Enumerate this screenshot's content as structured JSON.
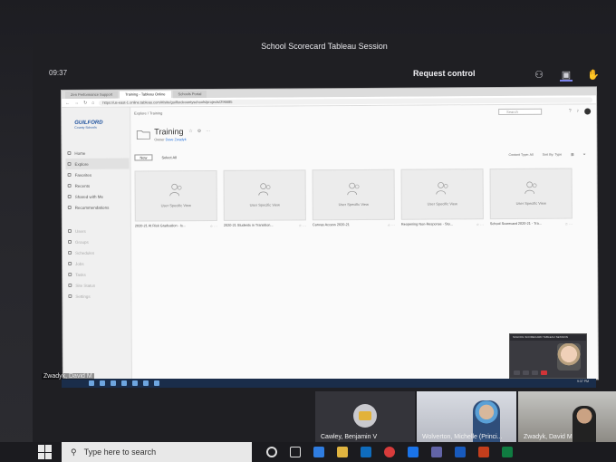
{
  "teams": {
    "title": "School Scorecard Tableau Session",
    "time": "09:37",
    "request_control": "Request control"
  },
  "browser": {
    "tabs": [
      "Zen Performance Support",
      "Training - Tableau Online",
      "Schools Portal"
    ],
    "url": "https://us-east-1.online.tableau.com/#/site/guilfordcountyschools/projects/296685"
  },
  "sidebar": {
    "logo_title": "GUILFORD",
    "logo_sub": "County Schools",
    "items": [
      {
        "label": "Home"
      },
      {
        "label": "Explore"
      },
      {
        "label": "Favorites"
      },
      {
        "label": "Recents"
      },
      {
        "label": "Shared with Me"
      },
      {
        "label": "Recommendations"
      }
    ],
    "admin_items": [
      {
        "label": "Users"
      },
      {
        "label": "Groups"
      },
      {
        "label": "Schedules"
      },
      {
        "label": "Jobs"
      },
      {
        "label": "Tasks"
      },
      {
        "label": "Site Status"
      },
      {
        "label": "Settings"
      }
    ]
  },
  "content": {
    "breadcrumb": "Explore / Training",
    "search_placeholder": "Search",
    "project_title": "Training",
    "owner_label": "Owner",
    "owner_name": "Dave Zwadyk",
    "new_label": "New",
    "select_all": "Select All",
    "content_type_label": "Content Type:",
    "content_type_value": "All",
    "sort_label": "Sort By:",
    "sort_value": "Type",
    "cards": [
      {
        "thumb_label": "User Specific View",
        "title": "2020-21 At Risk Graduation - Is..."
      },
      {
        "thumb_label": "User Specific View",
        "title": "2020-21 Students in Transition..."
      },
      {
        "thumb_label": "User Specific View",
        "title": "Canvas Access 2020-21"
      },
      {
        "thumb_label": "User Specific View",
        "title": "Reopening Non-Response - Stu..."
      },
      {
        "thumb_label": "User Specific View",
        "title": "School Scorecard 2020-21 - Tra..."
      }
    ]
  },
  "pip": {
    "label": "SCHOOL SCORECARD TABLEAU SESSION"
  },
  "self_name_tag": "Zwadyk, David M",
  "small_taskbar_time": "9:37 PM",
  "participants": [
    {
      "name": "Cawley, Benjamin V"
    },
    {
      "name": "Wolverton, Michelle (Princi..."
    },
    {
      "name": "Zwadyk, David M"
    }
  ],
  "taskbar": {
    "search_placeholder": "Type here to search"
  }
}
